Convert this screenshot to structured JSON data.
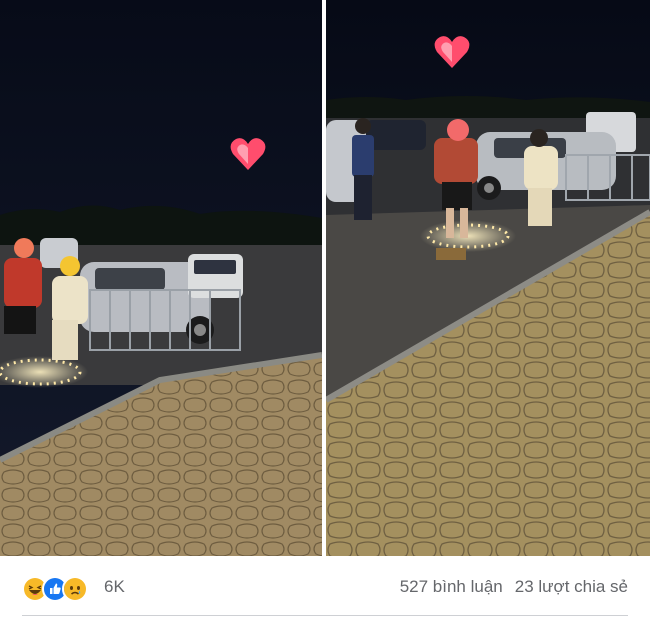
{
  "post": {
    "reactions": {
      "icons": [
        "haha-icon",
        "like-icon",
        "sad-icon"
      ],
      "count": "6K"
    },
    "comments": "527 bình luận",
    "shares": "23 lượt chia sẻ"
  },
  "colors": {
    "muted_text": "#65676b",
    "like_blue": "#1877f2",
    "reaction_yellow": "#f7b928",
    "heart_red": "#e8334a"
  }
}
